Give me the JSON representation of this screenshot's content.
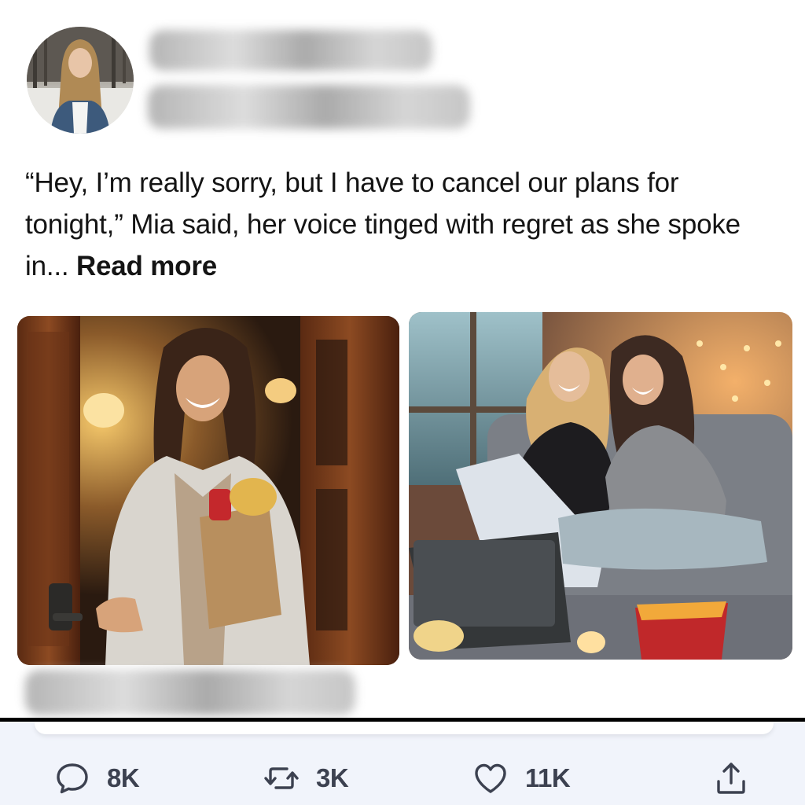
{
  "post": {
    "text": "“Hey, I’m really sorry, but I have to cancel our plans for tonight,” Mia said, her voice tinged with regret as she spoke in...",
    "read_more_label": "Read more"
  },
  "actions": {
    "comments": {
      "icon": "speech-bubble-icon",
      "count": "8K"
    },
    "reposts": {
      "icon": "repost-arrows-icon",
      "count": "3K"
    },
    "likes": {
      "icon": "heart-icon",
      "count": "11K"
    },
    "share": {
      "icon": "share-upload-icon"
    }
  },
  "colors": {
    "text": "#141414",
    "count_text": "#3c4150",
    "action_bar_bg": "#f1f4fb",
    "divider": "#000000"
  }
}
